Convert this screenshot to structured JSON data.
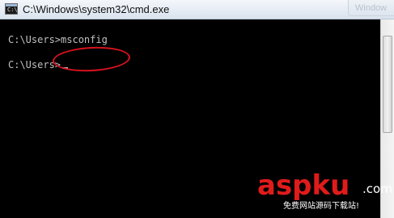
{
  "window": {
    "title": "C:\\Windows\\system32\\cmd.exe",
    "ghost_title": "Window",
    "icon": "cmd-icon"
  },
  "console": {
    "prompt": "C:\\Users>",
    "command": "msconfig",
    "lines": [
      "C:\\Users>msconfig",
      "C:\\Users>"
    ],
    "text_color": "#c0c0c0",
    "background": "#000000"
  },
  "annotation": {
    "shape": "ellipse",
    "color": "#d8121e",
    "target": "command"
  },
  "watermark": {
    "logo": "aspku",
    "domain_suffix": ".com",
    "tagline": "免费网站源码下载站!",
    "color": "#e01b1b"
  }
}
